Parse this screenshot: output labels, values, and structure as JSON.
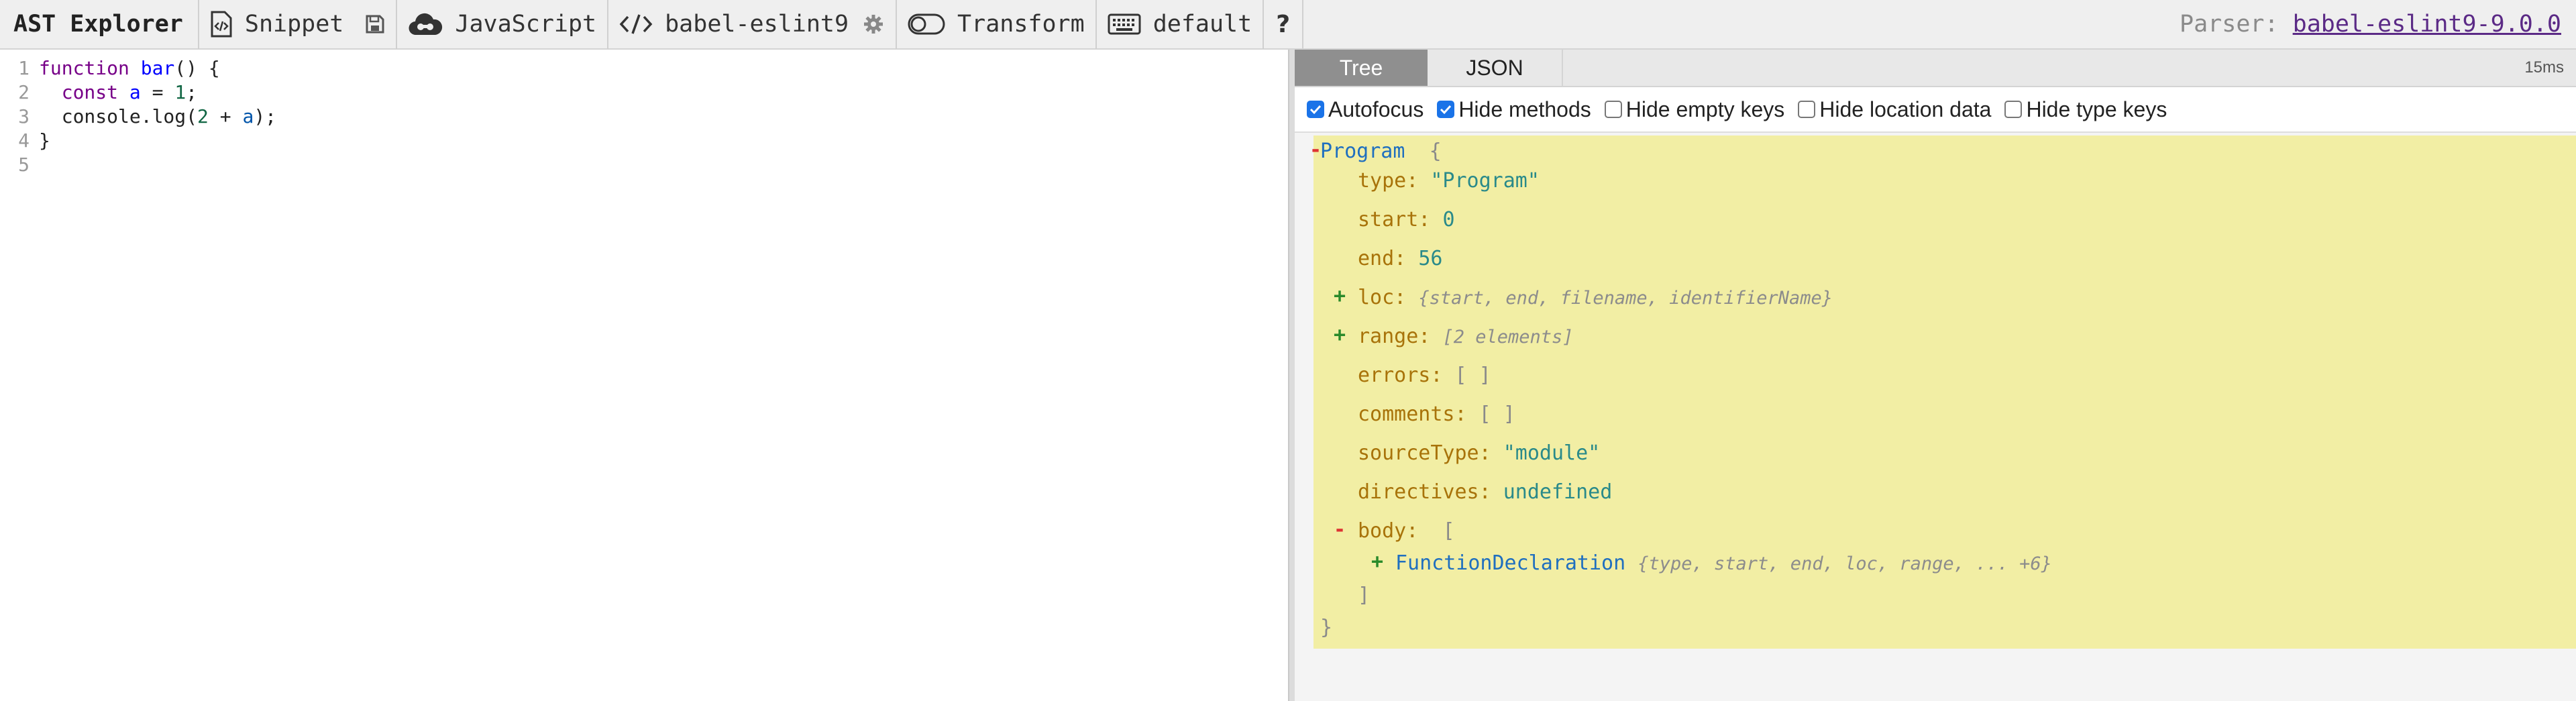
{
  "toolbar": {
    "title": "AST Explorer",
    "snippet_label": "Snippet",
    "language_label": "JavaScript",
    "parser_label": "babel-eslint9",
    "transform_label": "Transform",
    "keymap_label": "default",
    "help_label": "?",
    "parser_prefix": "Parser:",
    "parser_link": "babel-eslint9-9.0.0"
  },
  "editor": {
    "lines": [
      {
        "num": "1",
        "code": "function bar() {"
      },
      {
        "num": "2",
        "code": "  const a = 1;"
      },
      {
        "num": "3",
        "code": "  console.log(2 + a);"
      },
      {
        "num": "4",
        "code": "}"
      },
      {
        "num": "5",
        "code": ""
      }
    ]
  },
  "panel": {
    "tabs": [
      "Tree",
      "JSON"
    ],
    "active_tab": "Tree",
    "timing": "15ms",
    "options": [
      {
        "label": "Autofocus",
        "checked": true
      },
      {
        "label": "Hide methods",
        "checked": true
      },
      {
        "label": "Hide empty keys",
        "checked": false
      },
      {
        "label": "Hide location data",
        "checked": false
      },
      {
        "label": "Hide type keys",
        "checked": false
      }
    ]
  },
  "tree": {
    "root": "Program",
    "type_key": "type:",
    "type_val": "\"Program\"",
    "start_key": "start:",
    "start_val": "0",
    "end_key": "end:",
    "end_val": "56",
    "loc_key": "loc:",
    "loc_summary": "{start, end, filename, identifierName}",
    "range_key": "range:",
    "range_summary": "[2 elements]",
    "errors_key": "errors:",
    "errors_val": "[ ]",
    "comments_key": "comments:",
    "comments_val": "[ ]",
    "sourceType_key": "sourceType:",
    "sourceType_val": "\"module\"",
    "directives_key": "directives:",
    "directives_val": "undefined",
    "body_key": "body:",
    "body_child": "FunctionDeclaration",
    "body_child_summary": "{type, start, end, loc, range, ... +6}"
  },
  "colors": {
    "tree_bg": "#f2eea4",
    "node_name": "#1f6fbf",
    "key": "#a8730a",
    "value": "#2a8a8a",
    "collapse": "#d33",
    "expand": "#2a8a2a"
  }
}
